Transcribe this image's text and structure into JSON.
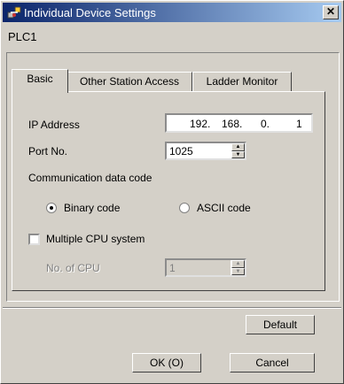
{
  "window": {
    "title": "Individual Device Settings",
    "close_glyph": "✕"
  },
  "device_name": "PLC1",
  "tabs": [
    {
      "label": "Basic",
      "active": true
    },
    {
      "label": "Other Station Access",
      "active": false
    },
    {
      "label": "Ladder Monitor",
      "active": false
    }
  ],
  "basic": {
    "ip_label": "IP Address",
    "ip": {
      "o1": "192.",
      "o2": "168.",
      "o3": "0.",
      "o4": "1"
    },
    "port_label": "Port No.",
    "port_value": "1025",
    "comm_label": "Communication data code",
    "radio_binary": "Binary code",
    "radio_ascii": "ASCII code",
    "selected_code": "Binary code",
    "multi_cpu_label": "Multiple CPU system",
    "multi_cpu_checked": false,
    "num_cpu_label": "No. of CPU",
    "num_cpu_value": "1"
  },
  "buttons": {
    "default": "Default",
    "ok": "OK (O)",
    "cancel": "Cancel"
  },
  "icons": {
    "app": "network-device-icon",
    "spin_up": "▲",
    "spin_down": "▼"
  }
}
